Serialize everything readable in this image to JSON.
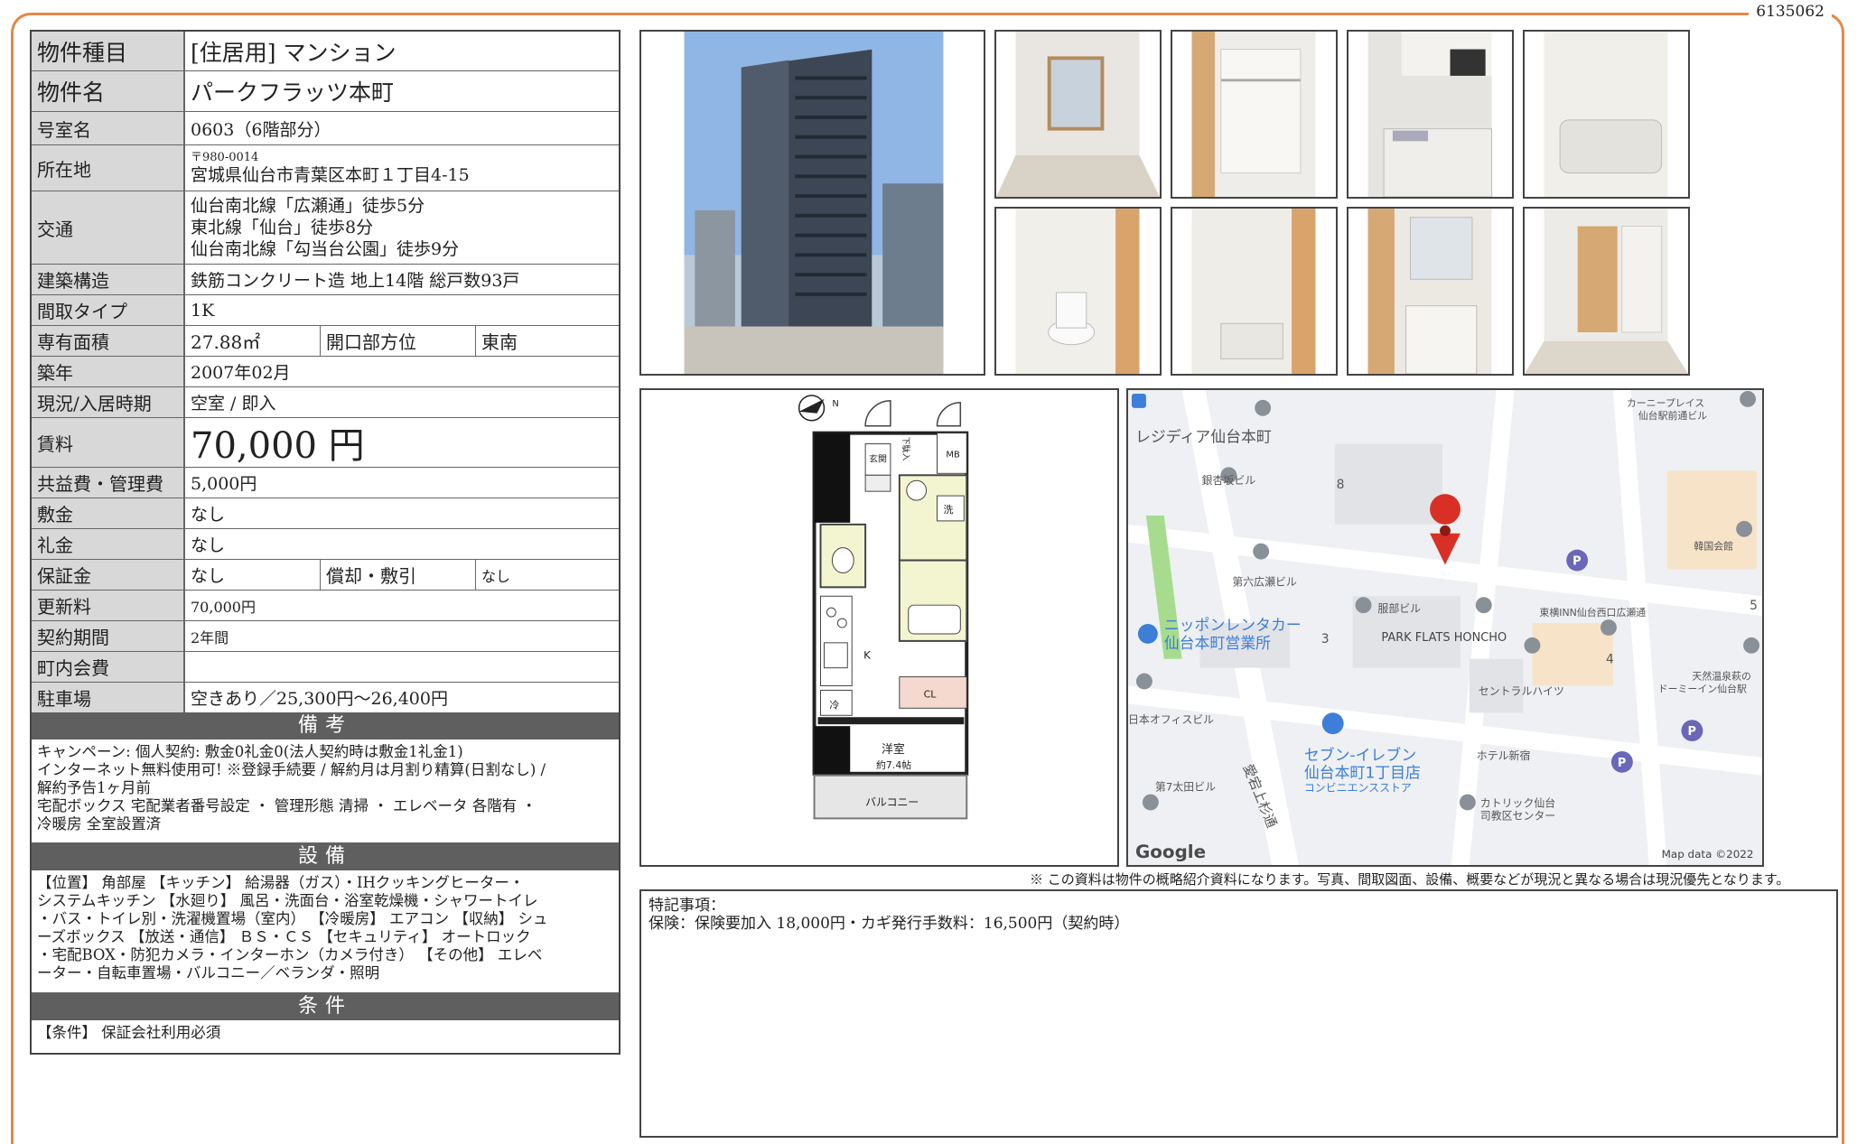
{
  "doc_id": "6135062",
  "spec": {
    "type_label": "物件種目",
    "type_value": "[住居用] マンション",
    "name_label": "物件名",
    "name_value": "パークフラッツ本町",
    "room_label": "号室名",
    "room_value": "0603（6階部分）",
    "address_label": "所在地",
    "postal": "〒980-0014",
    "address": "宮城県仙台市青葉区本町１丁目4-15",
    "access_label": "交通",
    "access": [
      "仙台南北線「広瀬通」徒歩5分",
      "東北線「仙台」徒歩8分",
      "仙台南北線「勾当台公園」徒歩9分"
    ],
    "structure_label": "建築構造",
    "structure_value": "鉄筋コンクリート造 地上14階 総戸数93戸",
    "layout_label": "間取タイプ",
    "layout_value": "1K",
    "area_label": "専有面積",
    "area_value": "27.88㎡",
    "opening_label": "開口部方位",
    "opening_value": "東南",
    "built_label": "築年",
    "built_value": "2007年02月",
    "status_label": "現況/入居時期",
    "status_value": "空室 / 即入",
    "rent_label": "賃料",
    "rent_value": "70,000 円",
    "fee_label": "共益費・管理費",
    "fee_value": "5,000円",
    "deposit_label": "敷金",
    "deposit_value": "なし",
    "key_money_label": "礼金",
    "key_money_value": "なし",
    "guarantee_label": "保証金",
    "guarantee_value": "なし",
    "amort_label": "償却・敷引",
    "amort_value": "なし",
    "renewal_label": "更新料",
    "renewal_value": "70,000円",
    "contract_label": "契約期間",
    "contract_value": "2年間",
    "community_label": "町内会費",
    "community_value": "",
    "parking_label": "駐車場",
    "parking_value": "空きあり／25,300円〜26,400円"
  },
  "sections": {
    "remarks_head": "備考",
    "remarks_lines": [
      "キャンペーン: 個人契約: 敷金0礼金0(法人契約時は敷金1礼金1)",
      "インターネット無料使用可! ※登録手続要 / 解約月は月割り精算(日割なし) /",
      "解約予告1ヶ月前",
      "宅配ボックス 宅配業者番号設定 ・ 管理形態 清掃 ・ エレベータ 各階有 ・",
      "冷暖房 全室設置済"
    ],
    "equip_head": "設備",
    "equip_lines": [
      "【位置】 角部屋 【キッチン】 給湯器（ガス）・IHクッキングヒーター・",
      "システムキッチン 【水廻り】 風呂・洗面台・浴室乾燥機・シャワートイレ",
      "・バス・トイレ別・洗濯機置場（室内） 【冷暖房】 エアコン 【収納】 シュ",
      "ーズボックス 【放送・通信】 ＢＳ・ＣＳ 【セキュリティ】 オートロック",
      "・宅配BOX・防犯カメラ・インターホン（カメラ付き） 【その他】 エレベ",
      "ーター・自転車置場・バルコニー／ベランダ・照明"
    ],
    "cond_head": "条件",
    "cond_text": "【条件】 保証会社利用必須"
  },
  "floorplan": {
    "entrance": "玄関",
    "shoebox": "下駄入",
    "mb": "MB",
    "washer": "洗",
    "kitchen": "K",
    "fridge": "冷",
    "closet": "CL",
    "room": "洋室",
    "room_size": "約7.4帖",
    "balcony": "バルコニー"
  },
  "map": {
    "labels": [
      "レジディア仙台本町",
      "銀杏坂ビル",
      "8",
      "第六広瀬ビル",
      "服部ビル",
      "ニッポンレンタカー",
      "仙台本町営業所",
      "3",
      "PARK FLATS HONCHO",
      "東横INN仙台西口広瀬通",
      "セントラルハイツ",
      "4",
      "カーニープレイス",
      "仙台駅前通ビル",
      "韓国会館",
      "5",
      "天然温泉萩の",
      "ドーミーイン仙台駅",
      "日本オフィスビル",
      "セブン-イレブン",
      "仙台本町1丁目店",
      "コンビニエンスストア",
      "ホテル新宿",
      "第7太田ビル",
      "愛宕上杉通",
      "カトリック仙台",
      "司教区センター"
    ],
    "google": "Google",
    "copyright": "Map data ©2022"
  },
  "notice": "※ この資料は物件の概略紹介資料になります。写真、間取図面、設備、概要などが現況と異なる場合は現況優先となります。",
  "special_title": "特記事項：",
  "special_text": "保険：保険要加入 18,000円・カギ発行手数料：16,500円（契約時）"
}
